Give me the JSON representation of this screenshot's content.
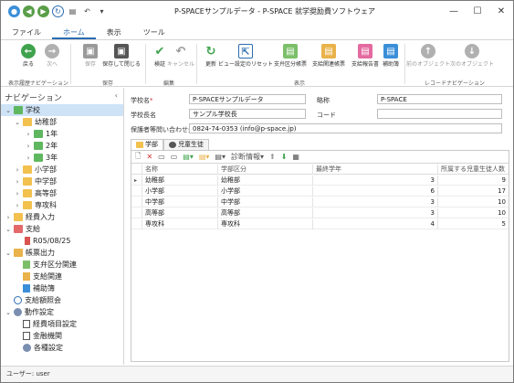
{
  "window": {
    "title": "P-SPACEサンプルデータ - P-SPACE 就学奨励費ソフトウェア"
  },
  "menu_tabs": [
    "ファイル",
    "ホーム",
    "表示",
    "ツール"
  ],
  "ribbon": {
    "buttons": {
      "back": "戻る",
      "forward": "次へ",
      "save": "保存",
      "save_close": "保存して閉じる",
      "verify": "検証",
      "cancel": "キャンセル",
      "refresh": "更新",
      "view_reset": "ビュー設定のリセット",
      "expense_category": "支弁区分帳票",
      "payment_related": "支給関連帳票",
      "payment_report": "支給報告書",
      "subsidy": "補助簿",
      "prev_object": "前のオブジェクト",
      "next_object": "次のオブジェクト"
    },
    "groups": {
      "history": "表示履歴ナビゲーション",
      "save": "保存",
      "edit": "編集",
      "view": "表示",
      "record": "レコードナビゲーション"
    }
  },
  "nav": {
    "header": "ナビゲーション",
    "items": [
      {
        "label": "学校"
      },
      {
        "label": "幼稚部"
      },
      {
        "label": "1年"
      },
      {
        "label": "2年"
      },
      {
        "label": "3年"
      },
      {
        "label": "小学部"
      },
      {
        "label": "中学部"
      },
      {
        "label": "高等部"
      },
      {
        "label": "専攻科"
      },
      {
        "label": "経費入力"
      },
      {
        "label": "支給"
      },
      {
        "label": "R05/08/25"
      },
      {
        "label": "帳票出力"
      },
      {
        "label": "支弁区分関連"
      },
      {
        "label": "支給関連"
      },
      {
        "label": "補助簿"
      },
      {
        "label": "支給額照会"
      },
      {
        "label": "動作設定"
      },
      {
        "label": "経費項目設定"
      },
      {
        "label": "金融機関"
      },
      {
        "label": "各種設定"
      }
    ]
  },
  "form": {
    "school_name_label": "学校名",
    "school_name_required": "*",
    "school_name": "P-SPACEサンプルデータ",
    "abbr_label": "略称",
    "abbr": "P-SPACE",
    "principal_label": "学校長名",
    "principal": "サンプル学校長",
    "code_label": "コード",
    "code": "",
    "contact_label": "保護者等問い合わせ先",
    "contact": "0824-74-0353 (info@p-space.jp)"
  },
  "subtabs": [
    "学部",
    "児童生徒"
  ],
  "grid": {
    "toolbar_diagnose": "診断情報",
    "columns": [
      "名称",
      "学部区分",
      "最終学年",
      "所属する児童生徒人数"
    ],
    "rows": [
      {
        "name": "幼稚部",
        "category": "幼稚部",
        "final_grade": "3",
        "count": "9"
      },
      {
        "name": "小学部",
        "category": "小学部",
        "final_grade": "6",
        "count": "17"
      },
      {
        "name": "中学部",
        "category": "中学部",
        "final_grade": "3",
        "count": "10"
      },
      {
        "name": "高等部",
        "category": "高等部",
        "final_grade": "3",
        "count": "10"
      },
      {
        "name": "専攻科",
        "category": "専攻科",
        "final_grade": "4",
        "count": "5"
      }
    ]
  },
  "status_bar": "ユーザー: user",
  "colors": {
    "accent": "#2b6cb0",
    "selected": "#cfe3f7",
    "folder": "#f2c14e",
    "green": "#3fa34d",
    "required": "#d32f2f"
  }
}
